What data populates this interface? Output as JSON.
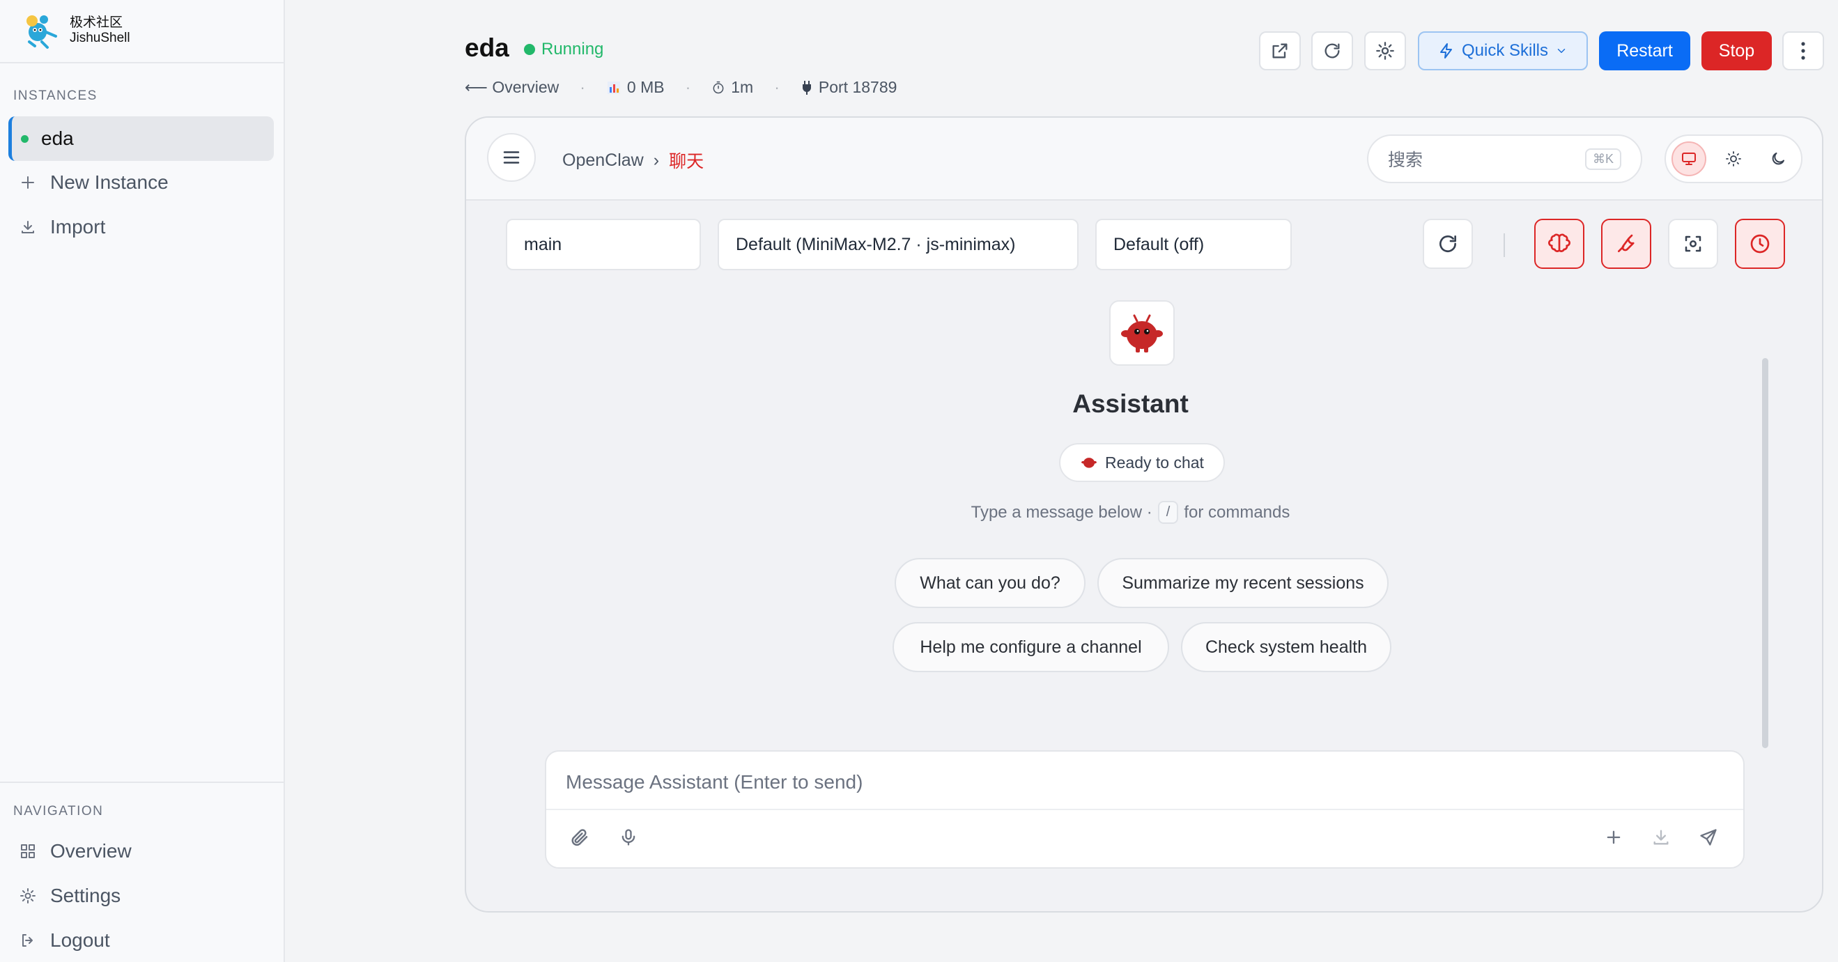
{
  "brand": {
    "line1": "极术社区",
    "line2": "JishuShell"
  },
  "sidebar": {
    "instances_heading": "INSTANCES",
    "active_instance": "eda",
    "new_instance": "New Instance",
    "import": "Import",
    "navigation_heading": "NAVIGATION",
    "nav": {
      "overview": "Overview",
      "settings": "Settings",
      "logout": "Logout"
    }
  },
  "header": {
    "title": "eda",
    "status": "Running",
    "back": "⟵ Overview",
    "memory": "0 MB",
    "uptime": "1m",
    "port": "Port 18789",
    "quick_skills": "Quick Skills",
    "restart": "Restart",
    "stop": "Stop"
  },
  "panel": {
    "breadcrumb": {
      "root": "OpenClaw",
      "separator": "›",
      "current": "聊天"
    },
    "search": {
      "label": "搜索",
      "shortcut": "⌘K"
    },
    "selectors": {
      "agent": "main",
      "model": "Default (MiniMax-M2.7 · js-minimax)",
      "thinking": "Default (off)"
    },
    "assistant": {
      "name": "Assistant",
      "status": "Ready to chat",
      "hint_prefix": "Type a message below ·",
      "hint_key": "/",
      "hint_suffix": "for commands"
    },
    "suggestions": [
      "What can you do?",
      "Summarize my recent sessions",
      "Help me configure a channel",
      "Check system health"
    ],
    "composer": {
      "placeholder": "Message Assistant (Enter to send)"
    }
  },
  "colors": {
    "accent_red": "#dc2626",
    "accent_blue": "#0a6cf5",
    "status_green": "#22b86a"
  }
}
